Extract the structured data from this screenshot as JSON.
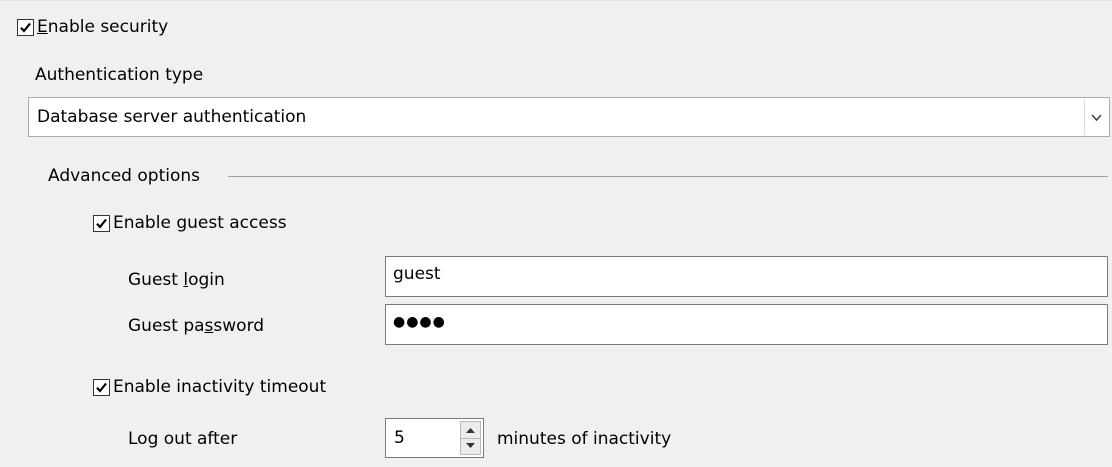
{
  "security": {
    "enable_label_prefix": "",
    "enable_label_mnemonic": "E",
    "enable_label_rest": "nable security",
    "enabled": true
  },
  "auth": {
    "type_label": "Authentication type",
    "selected_value": "Database server authentication"
  },
  "advanced": {
    "group_label": "Advanced options",
    "guest_access": {
      "label_prefix": "Enable ",
      "label_mnemonic": "g",
      "label_rest": "uest access",
      "checked": true
    },
    "guest_login": {
      "label_prefix": "Guest ",
      "label_mnemonic": "l",
      "label_rest": "ogin",
      "value": "guest"
    },
    "guest_password": {
      "label_prefix": "Guest pa",
      "label_mnemonic": "s",
      "label_rest": "sword",
      "masked_value": "●●●●"
    },
    "inactivity": {
      "label": "Enable inactivity timeout",
      "checked": true,
      "logout_label": "Log out after",
      "minutes_value": "5",
      "suffix_label": "minutes of inactivity"
    }
  },
  "icons": {
    "checkmark": "checkmark-icon",
    "dropdown": "chevron-down-icon",
    "spin_up": "spin-up-icon",
    "spin_down": "spin-down-icon"
  }
}
